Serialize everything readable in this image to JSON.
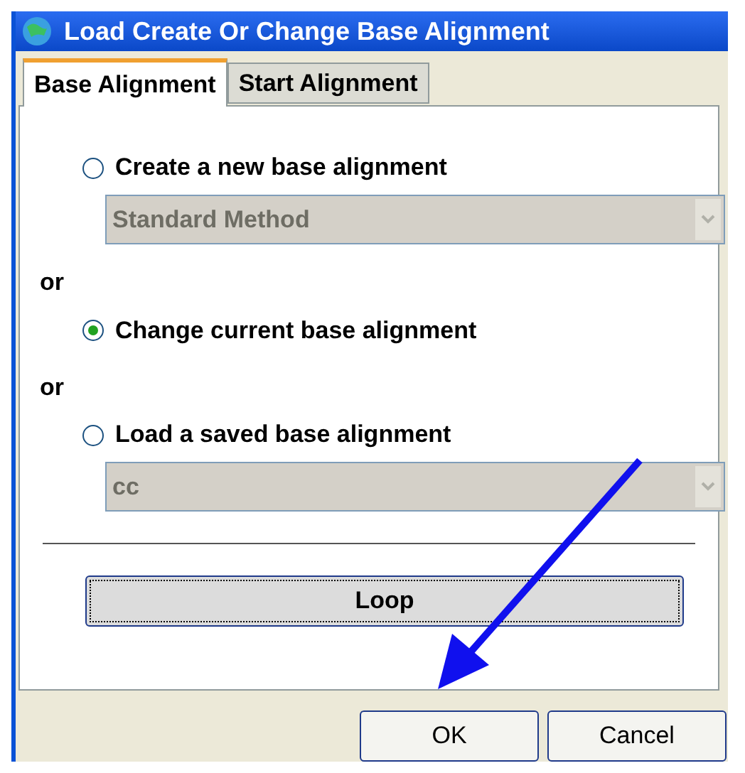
{
  "window": {
    "title": "Load Create Or Change Base Alignment"
  },
  "tabs": [
    {
      "label": "Base Alignment",
      "selected": true
    },
    {
      "label": "Start Alignment",
      "selected": false
    }
  ],
  "options": [
    {
      "kind": "radio",
      "label": "Create a new base alignment",
      "selected": false
    },
    {
      "kind": "dropdown",
      "value": "Standard Method",
      "disabled": true
    },
    {
      "kind": "separator",
      "label": "or"
    },
    {
      "kind": "radio",
      "label": "Change current base alignment",
      "selected": true
    },
    {
      "kind": "separator",
      "label": "or"
    },
    {
      "kind": "radio",
      "label": "Load a saved base alignment",
      "selected": false
    },
    {
      "kind": "dropdown",
      "value": "cc",
      "disabled": true
    }
  ],
  "loop_button": {
    "label": "Loop"
  },
  "buttons": [
    "OK",
    "Cancel"
  ]
}
